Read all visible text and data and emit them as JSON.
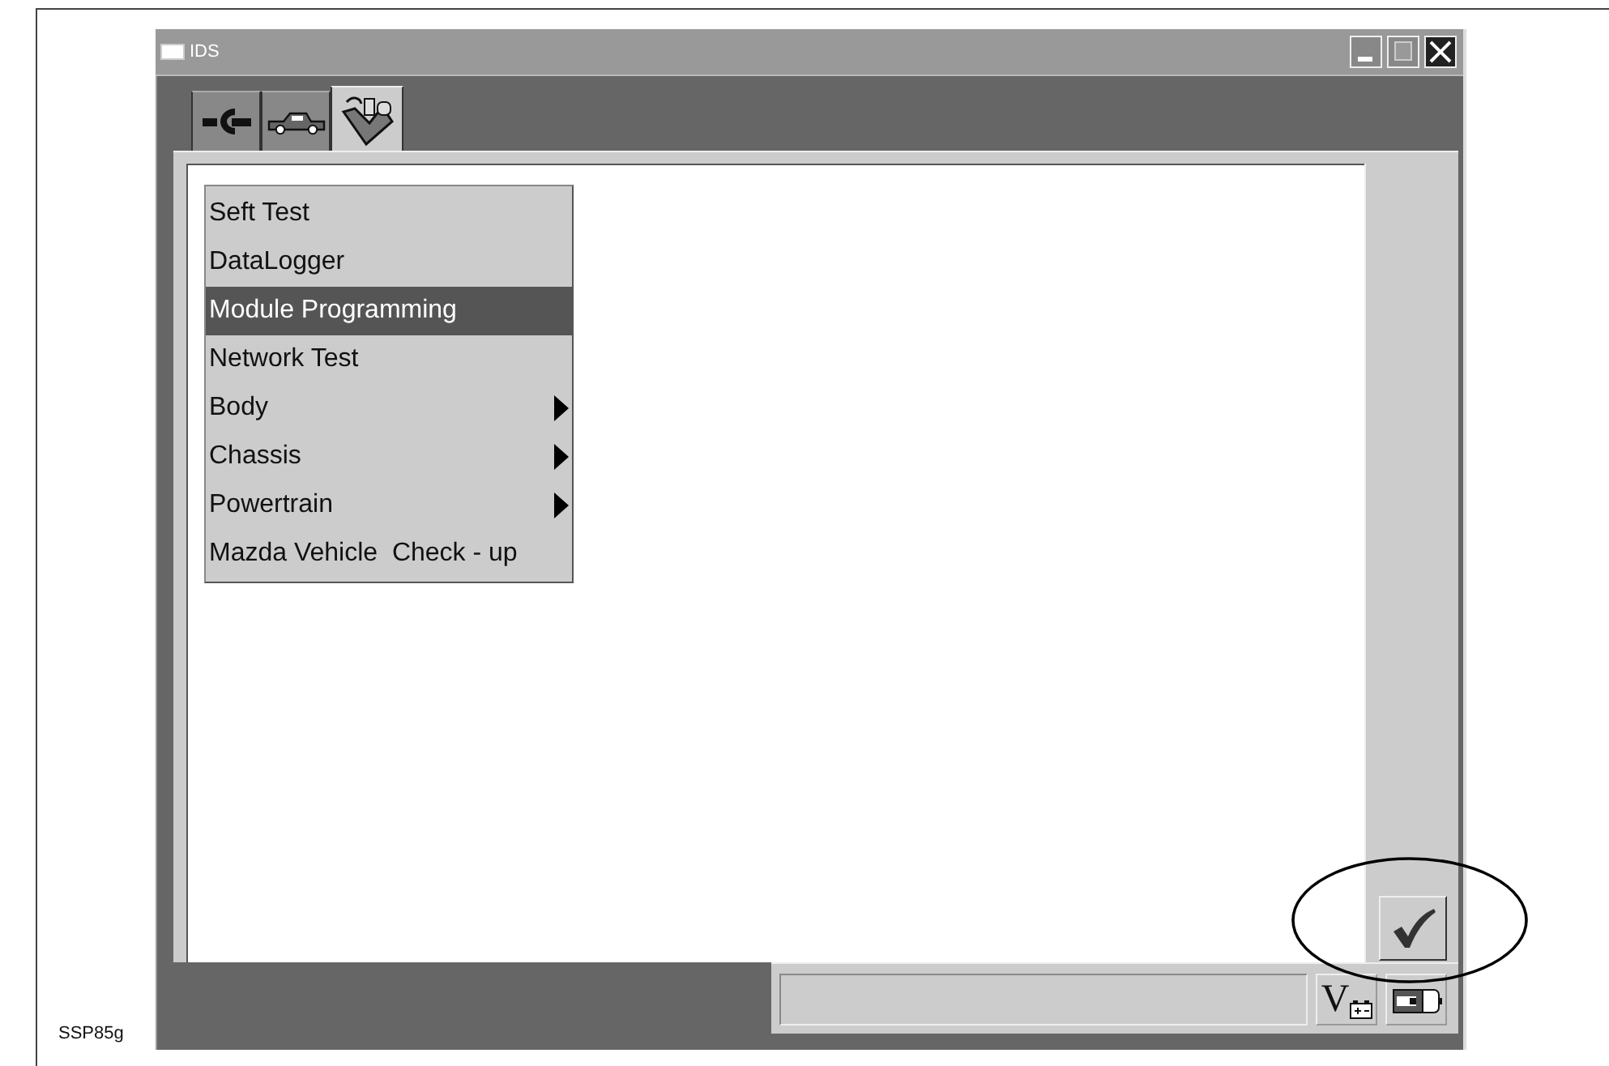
{
  "caption": "SSP85g",
  "window": {
    "title": "IDS",
    "controls": [
      {
        "kind": "minimize"
      },
      {
        "kind": "maximize"
      },
      {
        "kind": "close"
      }
    ]
  },
  "tabs": [
    {
      "kind": "connector",
      "selected": false
    },
    {
      "kind": "vehicle",
      "selected": false
    },
    {
      "kind": "toolbox",
      "selected": true
    }
  ],
  "menu": [
    {
      "label": "Seft Test",
      "selected": false,
      "submenu": false
    },
    {
      "label": "DataLogger",
      "selected": false,
      "submenu": false
    },
    {
      "label": "Module Programming",
      "selected": true,
      "submenu": false
    },
    {
      "label": "Network Test",
      "selected": false,
      "submenu": false
    },
    {
      "label": "Body",
      "selected": false,
      "submenu": true
    },
    {
      "label": "Chassis",
      "selected": false,
      "submenu": true
    },
    {
      "label": "Powertrain",
      "selected": false,
      "submenu": true
    },
    {
      "label": "Mazda Vehicle  Check - up",
      "selected": false,
      "submenu": false
    }
  ],
  "status_buttons": [
    {
      "kind": "voltage",
      "label": "V"
    },
    {
      "kind": "battery"
    }
  ],
  "confirm_button": {
    "kind": "check"
  },
  "annotation": {
    "kind": "ellipse"
  }
}
